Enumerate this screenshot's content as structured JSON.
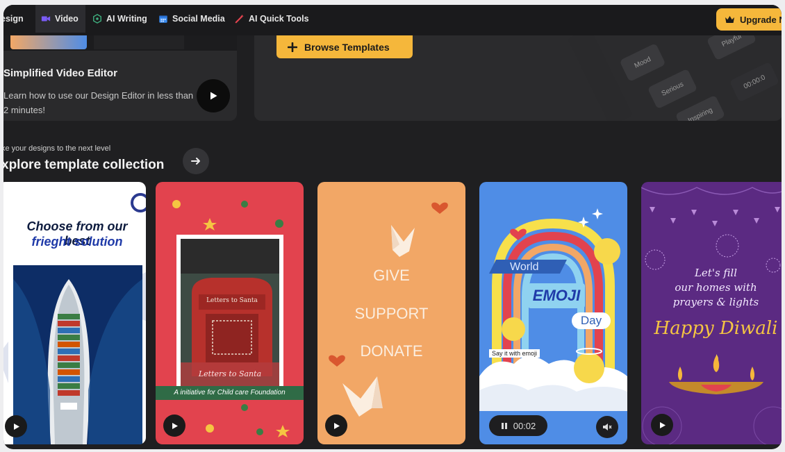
{
  "nav": {
    "items": [
      {
        "label": "esign",
        "icon": "design-icon"
      },
      {
        "label": "Video",
        "icon": "video-camera-icon"
      },
      {
        "label": "AI Writing",
        "icon": "ai-writing-icon"
      },
      {
        "label": "Social Media",
        "icon": "calendar-icon"
      },
      {
        "label": "AI Quick Tools",
        "icon": "magic-wand-icon"
      }
    ],
    "upgrade_label": "Upgrade N"
  },
  "video_card": {
    "title": "Simplified Video Editor",
    "description": "Learn how to use our Design Editor in less than 2 minutes!"
  },
  "promo": {
    "browse_label": "Browse Templates",
    "mock_keys": [
      "Mood",
      "Playful",
      "Serious",
      "Inspiring",
      "00:00:0"
    ]
  },
  "section": {
    "sub_label": "ke your designs to the next level",
    "title": "xplore template collection"
  },
  "templates": {
    "freight": {
      "line1": "Choose from our best",
      "line2": "frieght solution"
    },
    "santa": {
      "mailbox_text": "Letters to Santa",
      "caption_script": "Letters to Santa",
      "banner": "A initiative for Child care Foundation"
    },
    "support": {
      "words": [
        "GIVE",
        "SUPPORT",
        "DONATE"
      ]
    },
    "emoji": {
      "world": "World",
      "emoji": "EMOJI",
      "day": "Day",
      "say": "Say it with emoji",
      "time": "00:02"
    },
    "diwali": {
      "line1": "Let's fill",
      "line2": "our homes with",
      "line3": "prayers & lights",
      "headline": "Happy Diwali"
    }
  },
  "colors": {
    "accent": "#f5b73b",
    "santa_red": "#e2434e",
    "support_orange": "#f2a766",
    "emoji_blue": "#4f8de6",
    "diwali_purple": "#5b2a82"
  }
}
